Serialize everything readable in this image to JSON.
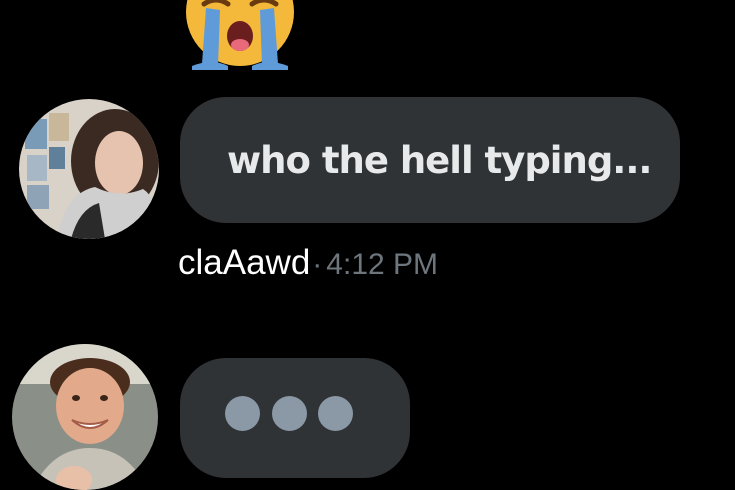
{
  "reaction": {
    "icon": "loudly-crying-face-icon",
    "face_color": "#f4b93b",
    "tear_color": "#5f9bd8"
  },
  "messages": [
    {
      "avatar": "avatar-icon",
      "text": "who the hell typing...",
      "bubble_color": "#2f3336"
    }
  ],
  "meta": {
    "username": "claAawd",
    "separator": "·",
    "timestamp": "4:12 PM"
  },
  "typing_indicator": {
    "icon": "typing-dots-icon",
    "dot_color": "#8b98a5"
  }
}
